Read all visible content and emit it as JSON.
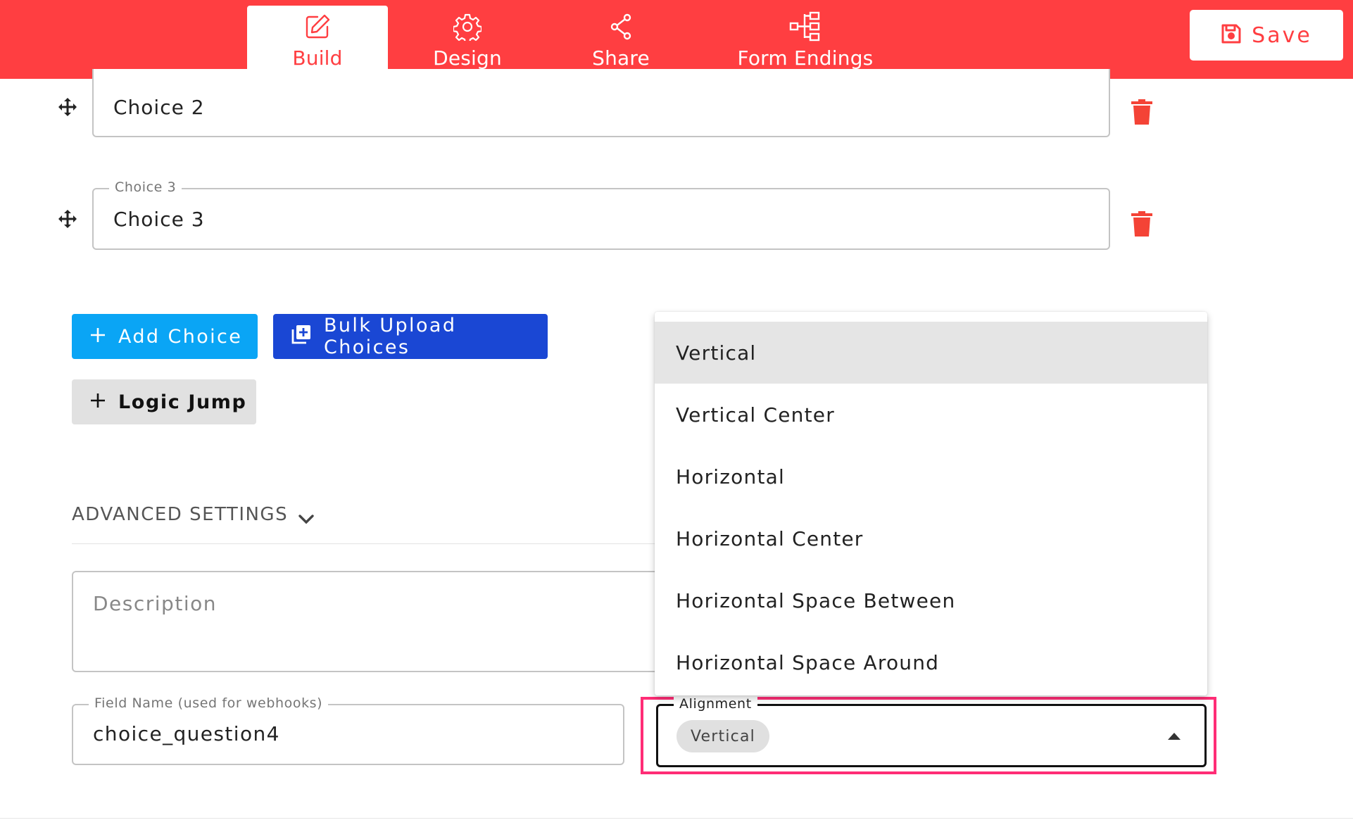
{
  "colors": {
    "brand_red": "#ff3e41",
    "add_choice_blue": "#0aa5f5",
    "bulk_upload_blue": "#1a47d4",
    "highlight_pink": "#ff2d76"
  },
  "nav": {
    "tabs": [
      {
        "label": "Build",
        "icon": "pencil-square-icon",
        "active": true
      },
      {
        "label": "Design",
        "icon": "gear-icon",
        "active": false
      },
      {
        "label": "Share",
        "icon": "share-icon",
        "active": false
      },
      {
        "label": "Form Endings",
        "icon": "flow-diagram-icon",
        "active": false
      }
    ],
    "save_label": "Save"
  },
  "choices": [
    {
      "label": "Choice 2",
      "value": "Choice 2"
    },
    {
      "label": "Choice 3",
      "value": "Choice 3"
    }
  ],
  "buttons": {
    "add_choice": "Add Choice",
    "bulk_upload": "Bulk Upload Choices",
    "logic_jump": "Logic Jump"
  },
  "advanced_settings": {
    "label": "ADVANCED SETTINGS",
    "description_placeholder": "Description",
    "field_name_label": "Field Name (used for webhooks)",
    "field_name_value": "choice_question4"
  },
  "alignment": {
    "label": "Alignment",
    "selected": "Vertical",
    "options": [
      "Vertical",
      "Vertical Center",
      "Horizontal",
      "Horizontal Center",
      "Horizontal Space Between",
      "Horizontal Space Around"
    ]
  }
}
